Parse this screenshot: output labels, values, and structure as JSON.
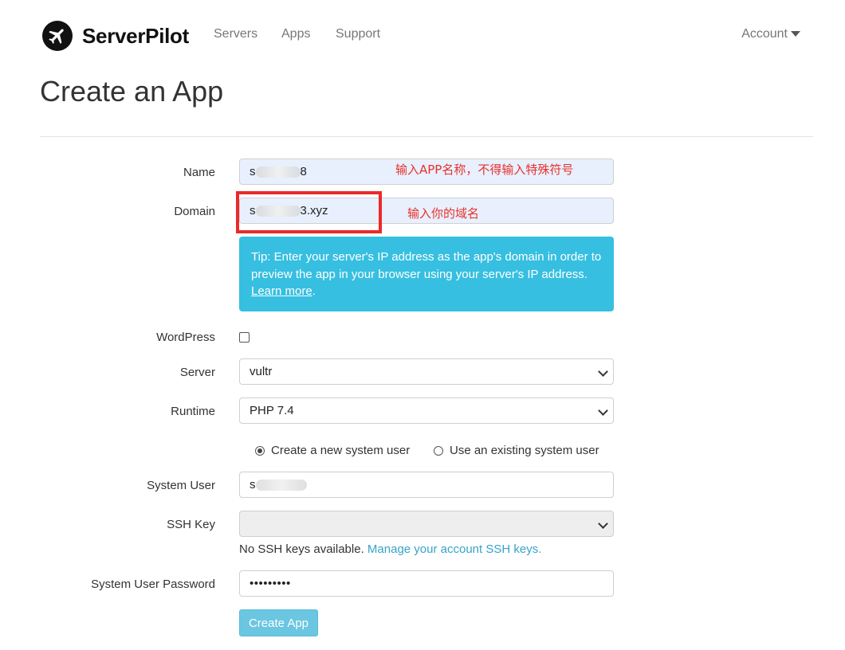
{
  "brand": {
    "name": "ServerPilot",
    "logo_icon": "airplane-icon"
  },
  "nav": {
    "items": [
      {
        "label": "Servers"
      },
      {
        "label": "Apps"
      },
      {
        "label": "Support"
      }
    ],
    "account_label": "Account"
  },
  "page": {
    "title": "Create an App"
  },
  "form": {
    "name": {
      "label": "Name",
      "value_start": "s",
      "value_end": "8"
    },
    "domain": {
      "label": "Domain",
      "value_start": "s",
      "value_end": "3.xyz"
    },
    "tip": {
      "text": "Tip: Enter your server's IP address as the app's domain in order to preview the app in your browser using your server's IP address.",
      "link_text": "Learn more",
      "suffix": "."
    },
    "wordpress": {
      "label": "WordPress",
      "checked": false
    },
    "server": {
      "label": "Server",
      "selected": "vultr"
    },
    "runtime": {
      "label": "Runtime",
      "selected": "PHP 7.4"
    },
    "user_mode": {
      "option_new": "Create a new system user",
      "option_existing": "Use an existing system user",
      "selected": "new"
    },
    "system_user": {
      "label": "System User",
      "value_start": "s"
    },
    "ssh_key": {
      "label": "SSH Key",
      "selected": "",
      "help_text": "No SSH keys available.",
      "help_link": "Manage your account SSH keys."
    },
    "password": {
      "label": "System User Password",
      "value": "•••••••••"
    },
    "submit_label": "Create App"
  },
  "annotations": {
    "name_hint": "输入APP名称，不得输入特殊符号",
    "domain_hint": "输入你的域名",
    "highlight_color": "#ea2a2a"
  },
  "colors": {
    "tip_bg": "#36bfe0",
    "button_bg": "#5bc0de",
    "link": "#36a3c9",
    "autofill_bg": "#e8f0fe"
  }
}
